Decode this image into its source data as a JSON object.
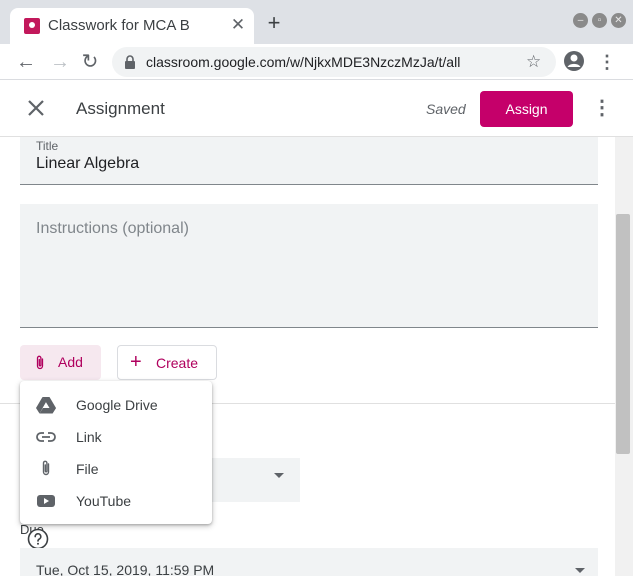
{
  "browser": {
    "tab_title": "Classwork for MCA B",
    "tab_close": "✕",
    "new_tab": "+",
    "url": "classroom.google.com/w/NjkxMDE3NzczMzJa/t/all",
    "nav_back": "←",
    "nav_forward": "→",
    "nav_reload": "↻",
    "star": "☆",
    "menu": "⋮",
    "window_buttons": {
      "minimize": "–",
      "maximize": "▫",
      "close": "✕"
    }
  },
  "header": {
    "title": "Assignment",
    "status": "Saved",
    "assign_label": "Assign",
    "more": "⋮"
  },
  "form": {
    "title_label": "Title",
    "title_value": "Linear Algebra",
    "instructions_placeholder": "Instructions (optional)",
    "add_label": "Add",
    "create_label": "Create",
    "create_plus": "+",
    "due_label": "Due",
    "due_value": "Tue, Oct 15, 2019, 11:59 PM"
  },
  "add_menu": {
    "items": [
      {
        "label": "Google Drive",
        "icon": "google-drive-icon"
      },
      {
        "label": "Link",
        "icon": "link-icon"
      },
      {
        "label": "File",
        "icon": "paperclip-icon"
      },
      {
        "label": "YouTube",
        "icon": "youtube-icon"
      }
    ]
  },
  "colors": {
    "accent": "#c5006a",
    "accent_text": "#b0005e",
    "field_bg": "#f1f3f4",
    "chrome_bg": "#dee1e6"
  }
}
